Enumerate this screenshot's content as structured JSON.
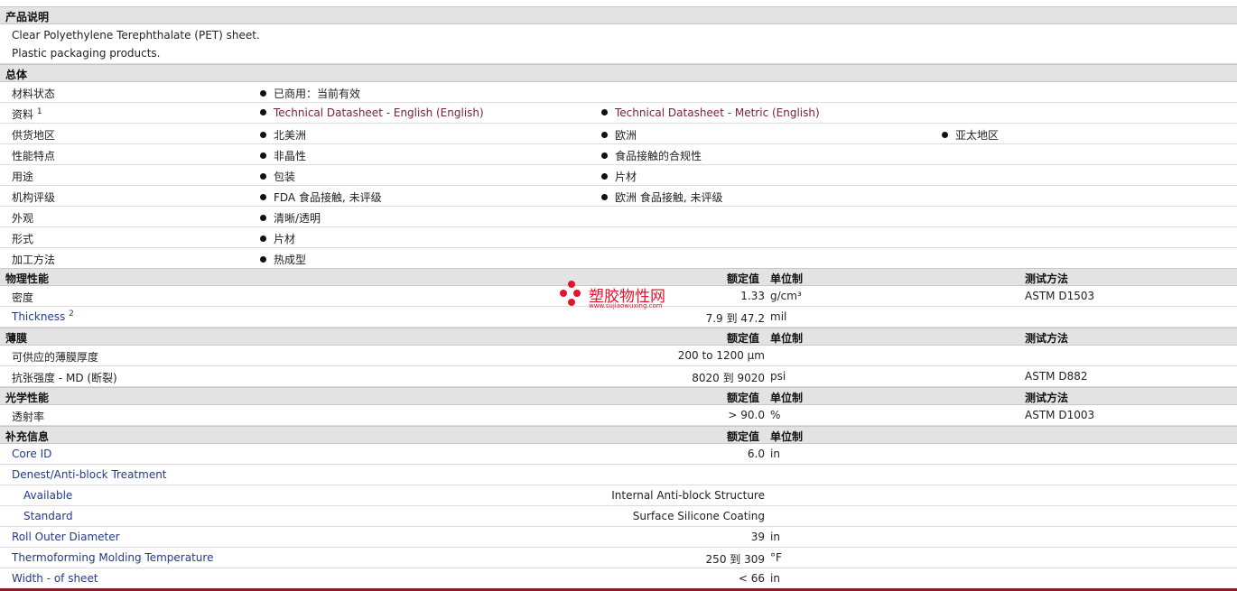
{
  "sections": {
    "description": {
      "title": "产品说明",
      "lines": [
        "Clear Polyethylene Terephthalate (PET) sheet.",
        "Plastic packaging products."
      ]
    },
    "general": {
      "title": "总体",
      "rows": [
        {
          "label": "材料状态",
          "items": [
            "已商用：当前有效"
          ]
        },
        {
          "label": "资料",
          "sup": "1",
          "items": [
            "Technical Datasheet - English (English)",
            "Technical Datasheet - Metric (English)"
          ]
        },
        {
          "label": "供货地区",
          "items": [
            "北美洲",
            "欧洲",
            "亚太地区"
          ]
        },
        {
          "label": "性能特点",
          "items": [
            "非晶性",
            "食品接触的合规性"
          ]
        },
        {
          "label": "用途",
          "items": [
            "包装",
            "片材"
          ]
        },
        {
          "label": "机构评级",
          "items": [
            "FDA 食品接触, 未评级",
            "欧洲 食品接触, 未评级"
          ]
        },
        {
          "label": "外观",
          "items": [
            "清晰/透明"
          ]
        },
        {
          "label": "形式",
          "items": [
            "片材"
          ]
        },
        {
          "label": "加工方法",
          "items": [
            "热成型"
          ]
        }
      ]
    },
    "col_headers": {
      "value": "额定值",
      "unit": "单位制",
      "method": "测试方法"
    },
    "physical": {
      "title": "物理性能",
      "rows": [
        {
          "label": "密度",
          "value": "1.33",
          "unit": "g/cm³",
          "method": "ASTM D1503"
        },
        {
          "label": "Thickness",
          "sup": "2",
          "value": "7.9 到  47.2",
          "unit": "mil",
          "method": ""
        }
      ]
    },
    "film": {
      "title": "薄膜",
      "rows": [
        {
          "label": "可供应的薄膜厚度",
          "value": "200 to 1200 µm",
          "unit": "",
          "method": ""
        },
        {
          "label": "抗张强度  - MD (断裂)",
          "value": "8020 到  9020",
          "unit": "psi",
          "method": "ASTM D882"
        }
      ]
    },
    "optical": {
      "title": "光学性能",
      "rows": [
        {
          "label": "透射率",
          "value": "> 90.0",
          "unit": "%",
          "method": "ASTM D1003"
        }
      ]
    },
    "supplemental": {
      "title": "补充信息",
      "rows": [
        {
          "label": "Core ID",
          "value": "6.0",
          "unit": "in"
        },
        {
          "label": "Denest/Anti-block Treatment",
          "value": "",
          "unit": ""
        },
        {
          "label": "Available",
          "value": "Internal Anti-block Structure",
          "unit": ""
        },
        {
          "label": "Standard",
          "value": "Surface Silicone Coating",
          "unit": ""
        },
        {
          "label": "Roll Outer Diameter",
          "value": "39",
          "unit": "in"
        },
        {
          "label": "Thermoforming Molding Temperature",
          "value": "250 到  309",
          "unit": "°F"
        },
        {
          "label": "Width - of sheet",
          "value": "< 66",
          "unit": "in"
        }
      ]
    }
  },
  "watermark": {
    "name": "塑胶物性网",
    "url": "www.sujiaowuxing.com"
  },
  "colors": {
    "header_bg": "#e3e3e3",
    "link": "#7a2040",
    "accent_red": "#e5142e",
    "bottom_bar": "#8c1a2a"
  }
}
